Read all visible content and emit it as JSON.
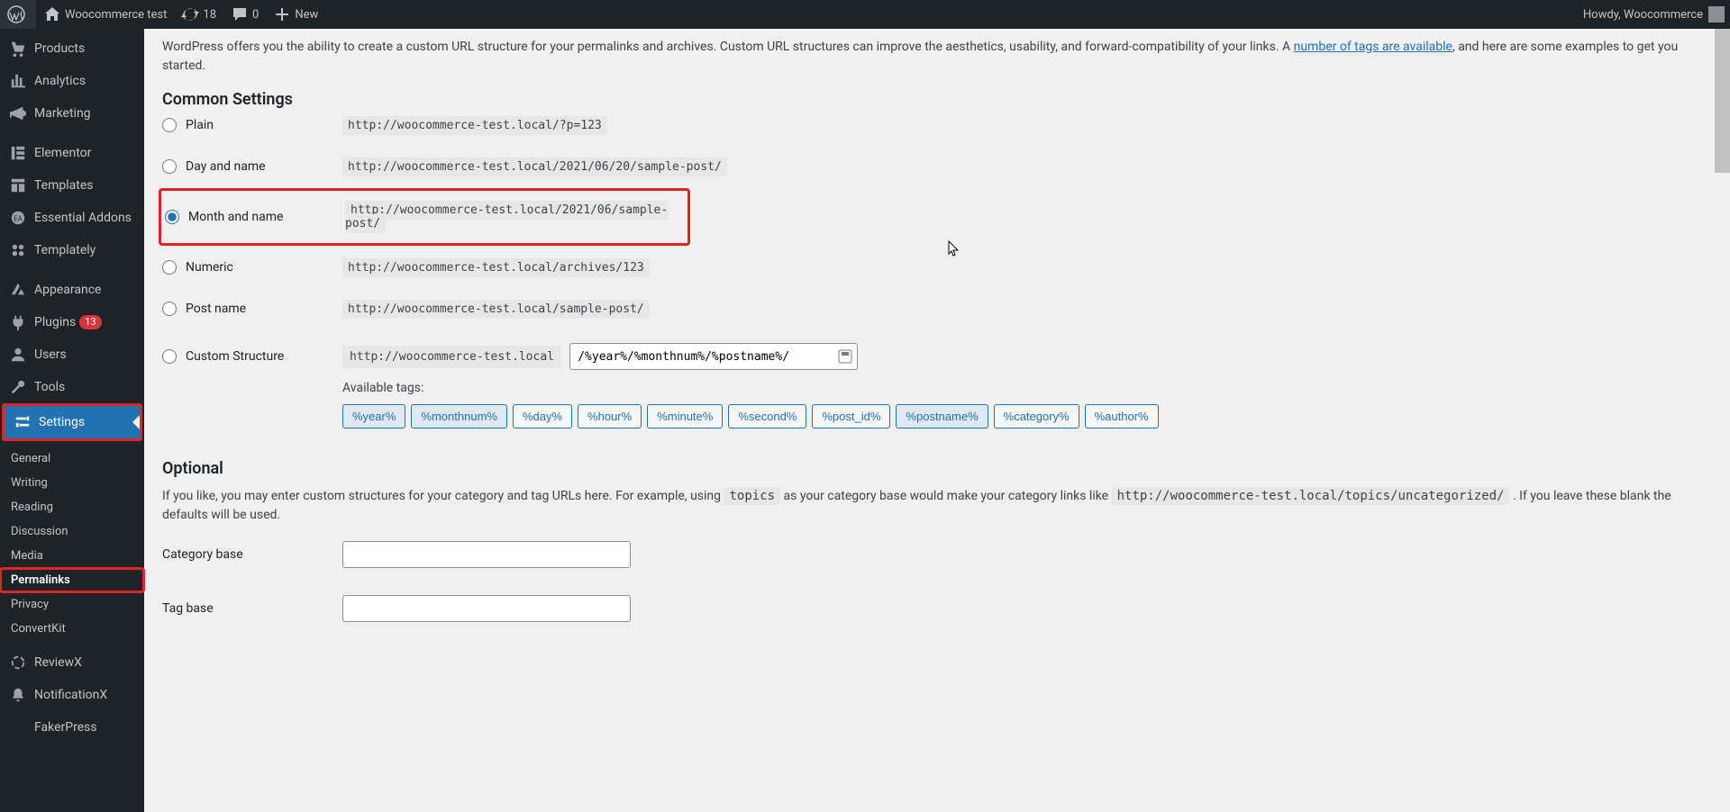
{
  "toolbar": {
    "site_name": "Woocommerce test",
    "updates": "18",
    "comments": "0",
    "new_label": "New",
    "howdy": "Howdy, Woocommerce"
  },
  "menu": {
    "products": "Products",
    "analytics": "Analytics",
    "marketing": "Marketing",
    "elementor": "Elementor",
    "templates": "Templates",
    "essential_addons": "Essential Addons",
    "templately": "Templately",
    "appearance": "Appearance",
    "plugins": "Plugins",
    "plugins_count": "13",
    "users": "Users",
    "tools": "Tools",
    "settings": "Settings",
    "reviewx": "ReviewX",
    "notificationx": "NotificationX",
    "fakerpress": "FakerPress"
  },
  "submenu": {
    "general": "General",
    "writing": "Writing",
    "reading": "Reading",
    "discussion": "Discussion",
    "media": "Media",
    "permalinks": "Permalinks",
    "privacy": "Privacy",
    "convertkit": "ConvertKit"
  },
  "intro": {
    "text1": "WordPress offers you the ability to create a custom URL structure for your permalinks and archives. Custom URL structures can improve the aesthetics, usability, and forward-compatibility of your links. A ",
    "link": "number of tags are available",
    "text2": ", and here are some examples to get you started."
  },
  "headings": {
    "common": "Common Settings",
    "optional": "Optional"
  },
  "permalinks": {
    "plain": {
      "label": "Plain",
      "example": "http://woocommerce-test.local/?p=123"
    },
    "day": {
      "label": "Day and name",
      "example": "http://woocommerce-test.local/2021/06/20/sample-post/"
    },
    "month": {
      "label": "Month and name",
      "example": "http://woocommerce-test.local/2021/06/sample-post/"
    },
    "numeric": {
      "label": "Numeric",
      "example": "http://woocommerce-test.local/archives/123"
    },
    "postname": {
      "label": "Post name",
      "example": "http://woocommerce-test.local/sample-post/"
    },
    "custom": {
      "label": "Custom Structure",
      "base": "http://woocommerce-test.local",
      "value": "/%year%/%monthnum%/%postname%/"
    }
  },
  "tags": {
    "label": "Available tags:",
    "items": [
      "%year%",
      "%monthnum%",
      "%day%",
      "%hour%",
      "%minute%",
      "%second%",
      "%post_id%",
      "%postname%",
      "%category%",
      "%author%"
    ]
  },
  "optional": {
    "text1": "If you like, you may enter custom structures for your category and tag URLs here. For example, using ",
    "code1": "topics",
    "text2": " as your category base would make your category links like ",
    "code2": "http://woocommerce-test.local/topics/uncategorized/",
    "text3": " . If you leave these blank the defaults will be used.",
    "category_base": "Category base",
    "tag_base": "Tag base"
  }
}
